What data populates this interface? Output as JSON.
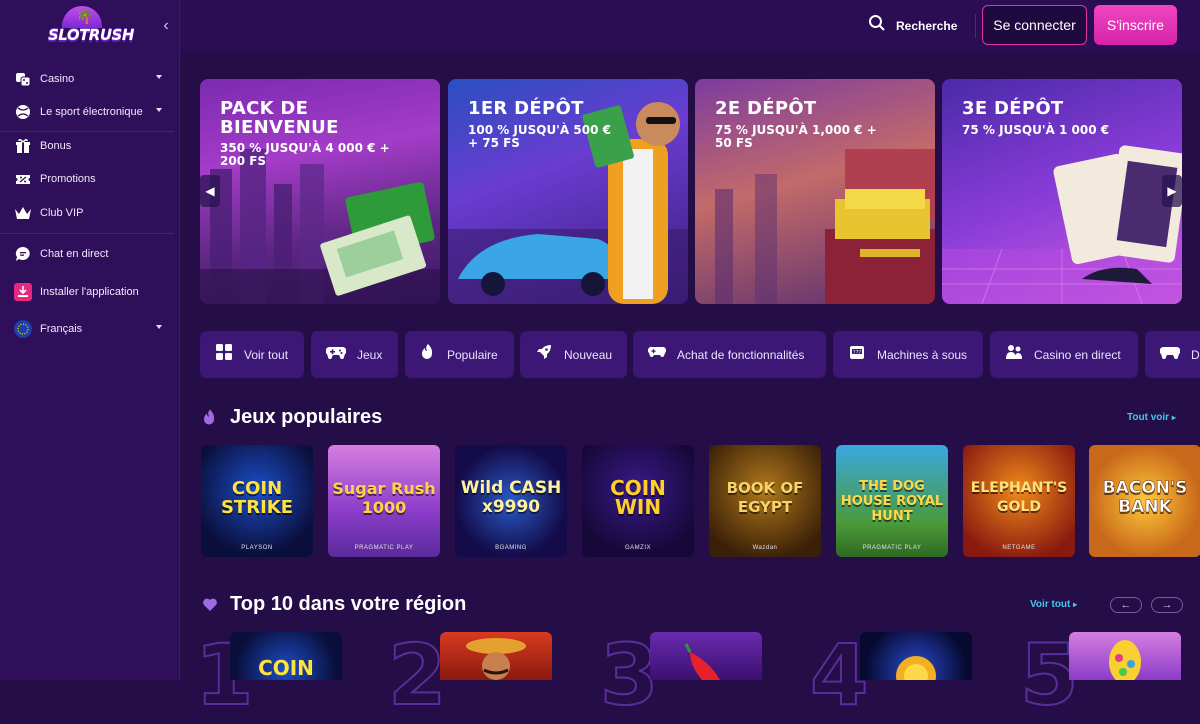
{
  "brand": {
    "logo_text": "SLOTRUSH"
  },
  "sidebar": {
    "items": [
      {
        "label": "Casino",
        "icon": "dice-icon"
      },
      {
        "label": "Le sport électronique",
        "icon": "ball-icon"
      },
      {
        "label": "Bonus",
        "icon": "gift-icon"
      },
      {
        "label": "Promotions",
        "icon": "ticket-icon"
      },
      {
        "label": "Club VIP",
        "icon": "crown-icon"
      },
      {
        "label": "Chat en direct",
        "icon": "chat-icon"
      },
      {
        "label": "Installer l'application",
        "icon": "download-icon"
      },
      {
        "label": "Français",
        "icon": "eu-flag-icon"
      }
    ]
  },
  "header": {
    "search_label": "Recherche",
    "login_label": "Se connecter",
    "signup_label": "S'inscrire"
  },
  "banners": [
    {
      "title": "PACK DE BIENVENUE",
      "subtitle": "350 % JUSQU'À 4 000 € + 200 FS"
    },
    {
      "title": "1ER DÉPÔT",
      "subtitle": "100 % JUSQU'À 500 € + 75 FS"
    },
    {
      "title": "2E DÉPÔT",
      "subtitle": "75 % JUSQU'À 1,000 € + 50 FS"
    },
    {
      "title": "3E DÉPÔT",
      "subtitle": "75 % JUSQU'À 1 000 €"
    }
  ],
  "categories": [
    {
      "label": "Voir tout",
      "icon": "grid-icon"
    },
    {
      "label": "Jeux",
      "icon": "gamepad-icon"
    },
    {
      "label": "Populaire",
      "icon": "flame-icon"
    },
    {
      "label": "Nouveau",
      "icon": "rocket-icon"
    },
    {
      "label": "Achat de fonctionnalités",
      "icon": "controller-icon"
    },
    {
      "label": "Machines à sous",
      "icon": "slot-machine-icon"
    },
    {
      "label": "Casino en direct",
      "icon": "live-dealer-icon"
    },
    {
      "label": "D",
      "icon": "gamepad-icon"
    }
  ],
  "popular": {
    "title": "Jeux populaires",
    "see_all": "Tout voir",
    "games": [
      {
        "name": "COIN STRIKE",
        "provider": "PLAYSON"
      },
      {
        "name": "Sugar Rush 1000",
        "provider": "PRAGMATIC PLAY"
      },
      {
        "name": "Wild CASH x9990",
        "provider": "BGAMING"
      },
      {
        "name": "COIN WIN",
        "provider": "GAMZIX"
      },
      {
        "name": "BOOK OF EGYPT",
        "provider": "Wazdan"
      },
      {
        "name": "THE DOG HOUSE ROYAL HUNT",
        "provider": "PRAGMATIC PLAY"
      },
      {
        "name": "ELEPHANT'S GOLD",
        "provider": "NETGAME"
      },
      {
        "name": "BACON'S BANK",
        "provider": ""
      }
    ]
  },
  "top10": {
    "title": "Top 10 dans votre région",
    "see_all": "Voir tout",
    "numbers": [
      "1",
      "2",
      "3",
      "4",
      "5"
    ],
    "games": [
      {
        "name": "COIN"
      },
      {
        "name": ""
      },
      {
        "name": ""
      },
      {
        "name": ""
      },
      {
        "name": ""
      }
    ]
  }
}
